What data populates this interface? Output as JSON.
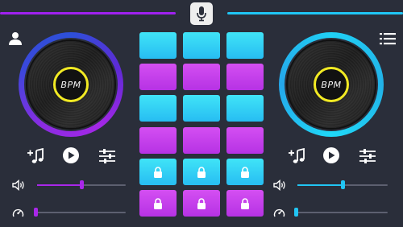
{
  "colors": {
    "background": "#2a2e3a",
    "left_accent": "#a021f0",
    "right_accent": "#1fc6f5",
    "pad_cyan": "#34d4f5",
    "pad_purple": "#c53cec",
    "bpm_ring": "#f2ea23"
  },
  "header": {
    "mic_icon": "microphone-icon",
    "profile_icon": "profile-icon",
    "menu_icon": "menu-list-icon"
  },
  "left_deck": {
    "label": "BPM",
    "controls": [
      "add-music-icon",
      "play-icon",
      "equalizer-icon"
    ],
    "volume": {
      "icon": "volume-icon",
      "level": 0.5
    },
    "pitch": {
      "icon": "speedometer-icon",
      "level": 0.0
    }
  },
  "right_deck": {
    "label": "BPM",
    "controls": [
      "add-music-icon",
      "play-icon",
      "equalizer-icon"
    ],
    "volume": {
      "icon": "volume-icon",
      "level": 0.5
    },
    "pitch": {
      "icon": "speedometer-icon",
      "level": 0.0
    }
  },
  "pads": {
    "rows": [
      {
        "color": "cyan",
        "locked": false
      },
      {
        "color": "purple",
        "locked": false
      },
      {
        "color": "cyan",
        "locked": false
      },
      {
        "color": "purple",
        "locked": false
      },
      {
        "color": "cyan",
        "locked": true
      },
      {
        "color": "purple",
        "locked": true
      }
    ],
    "columns": 3,
    "lock_icon": "lock-icon"
  }
}
